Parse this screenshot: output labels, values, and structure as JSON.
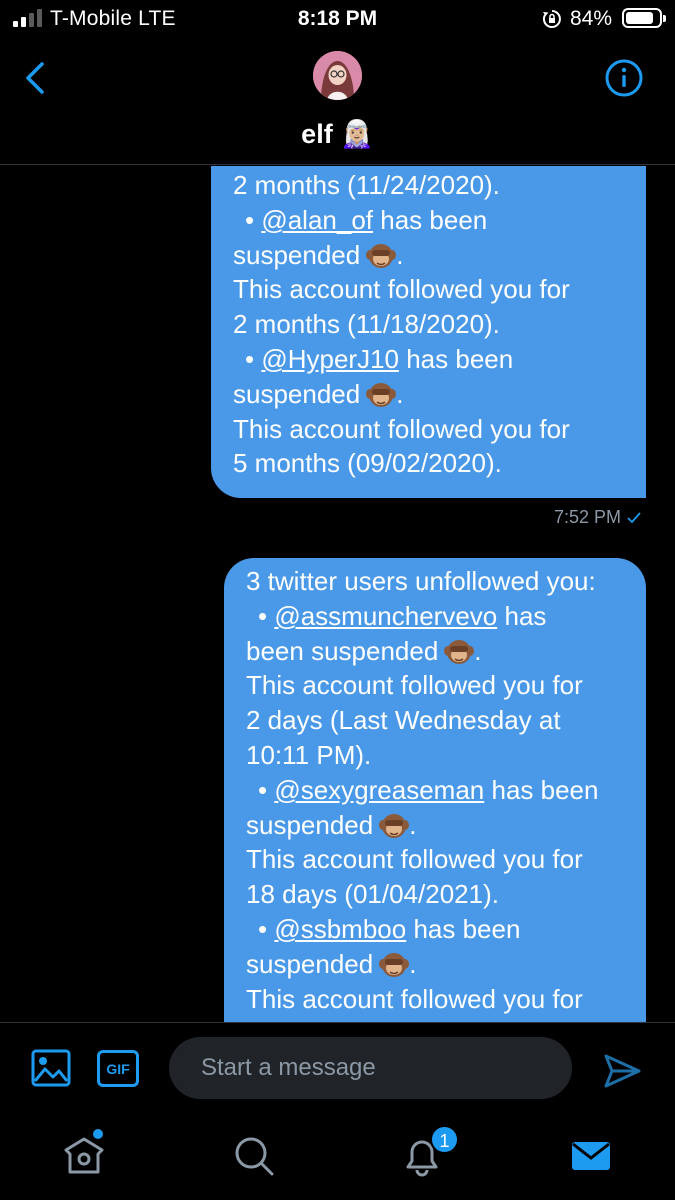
{
  "status_bar": {
    "carrier": "T-Mobile  LTE",
    "time": "8:18 PM",
    "battery_percent": "84%",
    "battery_level": 0.84,
    "signal_bars": 2
  },
  "header": {
    "contact_name": "elf 🧝🏼‍♀️",
    "back_icon": "chevron-left-icon",
    "info_icon": "info-icon"
  },
  "messages": [
    {
      "lines": [
        {
          "text": "2 months (11/24/2020)."
        },
        {
          "bullet": true,
          "mention": "@alan_of",
          "text": " has been"
        },
        {
          "text": "suspended",
          "emoji": "see-no-evil-monkey",
          "after": "."
        },
        {
          "text": "This account followed you for"
        },
        {
          "text": "2 months (11/18/2020)."
        },
        {
          "bullet": true,
          "mention": "@HyperJ10",
          "text": " has been"
        },
        {
          "text": "suspended",
          "emoji": "see-no-evil-monkey",
          "after": "."
        },
        {
          "text": "This account followed you for"
        },
        {
          "text": "5 months (09/02/2020)."
        }
      ],
      "time": "7:52 PM"
    },
    {
      "lines": [
        {
          "text": "3 twitter users unfollowed you:"
        },
        {
          "bullet": true,
          "mention": "@assmunchervevo",
          "text": " has"
        },
        {
          "text": "been suspended",
          "emoji": "see-no-evil-monkey",
          "after": "."
        },
        {
          "text": "This account followed you for"
        },
        {
          "text": "2 days (Last Wednesday at"
        },
        {
          "text": "10:11 PM)."
        },
        {
          "bullet": true,
          "mention": "@sexygreaseman",
          "text": " has been"
        },
        {
          "text": "suspended",
          "emoji": "see-no-evil-monkey",
          "after": "."
        },
        {
          "text": "This account followed you for"
        },
        {
          "text": "18 days (01/04/2021)."
        },
        {
          "bullet": true,
          "mention": "@ssbmboo",
          "text": " has been"
        },
        {
          "text": "suspended",
          "emoji": "see-no-evil-monkey",
          "after": "."
        },
        {
          "text": "This account followed you for"
        }
      ]
    }
  ],
  "composer": {
    "placeholder": "Start a message",
    "gif_label": "GIF"
  },
  "tabbar": {
    "notification_count": "1"
  },
  "colors": {
    "bubble": "#4a99e9",
    "accent": "#1d9bf0",
    "background": "#000000"
  }
}
